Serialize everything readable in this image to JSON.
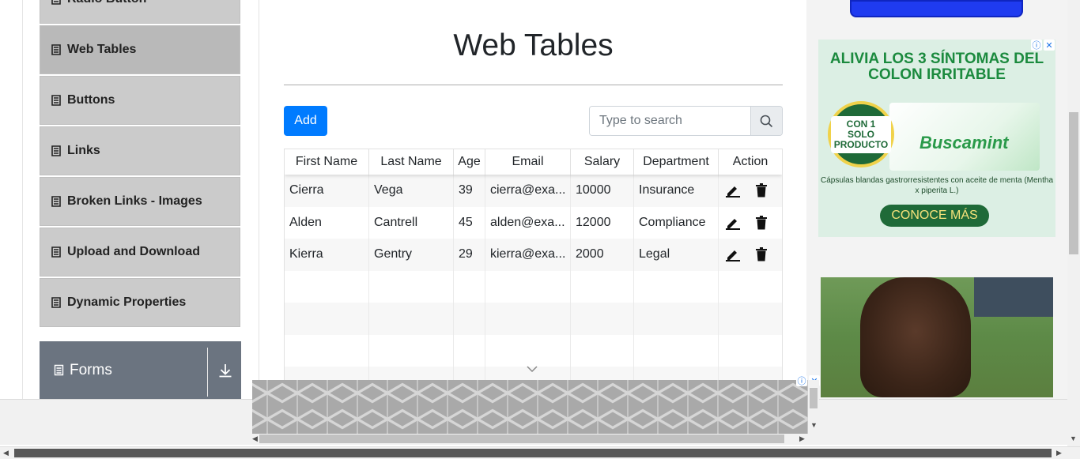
{
  "sidebar": {
    "partial_item": "Radio Button",
    "items": [
      {
        "label": "Web Tables",
        "active": true
      },
      {
        "label": "Buttons"
      },
      {
        "label": "Links"
      },
      {
        "label": "Broken Links - Images"
      },
      {
        "label": "Upload and Download"
      },
      {
        "label": "Dynamic Properties"
      }
    ],
    "group": {
      "label": "Forms"
    }
  },
  "main": {
    "title": "Web Tables",
    "add_label": "Add",
    "search_placeholder": "Type to search",
    "columns": [
      "First Name",
      "Last Name",
      "Age",
      "Email",
      "Salary",
      "Department",
      "Action"
    ],
    "rows": [
      {
        "first": "Cierra",
        "last": "Vega",
        "age": "39",
        "email": "cierra@exa...",
        "salary": "10000",
        "department": "Insurance"
      },
      {
        "first": "Alden",
        "last": "Cantrell",
        "age": "45",
        "email": "alden@exa...",
        "salary": "12000",
        "department": "Compliance"
      },
      {
        "first": "Kierra",
        "last": "Gentry",
        "age": "29",
        "email": "kierra@exa...",
        "salary": "2000",
        "department": "Legal"
      }
    ]
  },
  "ads": {
    "ad1": {
      "headline": "ALIVIA LOS 3  SÍNTOMAS DEL COLON IRRITABLE",
      "seal": "CON 1 SOLO PRODUCTO",
      "brand": "Buscamint",
      "sub": "Cápsulas blandas gastrorresistentes con aceite de menta (Mentha x piperita L.)",
      "cta": "CONOCE MÁS"
    },
    "info_glyph": "ⓘ",
    "close_glyph": "✕"
  },
  "colors": {
    "accent": "#007bff",
    "sidebar_item": "#cbcbcb",
    "sidebar_active": "#b9b9b9",
    "group_header": "#6b7480"
  }
}
